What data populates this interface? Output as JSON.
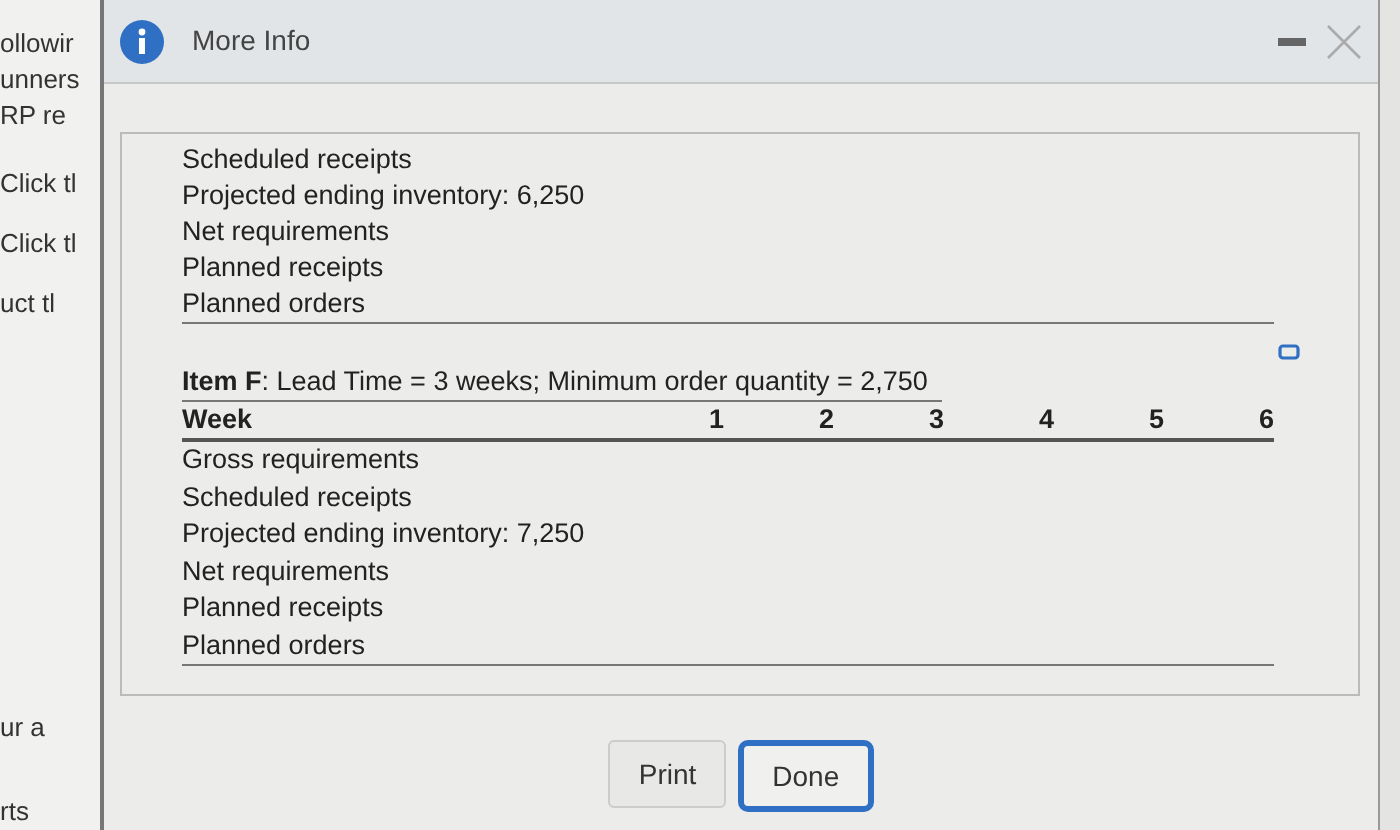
{
  "background_text": [
    "ollowir",
    "unners",
    "RP re",
    "Click tl",
    "Click tl",
    "uct tl",
    "ur a",
    "rts"
  ],
  "dialog": {
    "title": "More Info",
    "upper_table": {
      "rows": [
        "Scheduled receipts",
        "Projected ending inventory: 6,250",
        "Net requirements",
        "Planned receipts",
        "Planned orders"
      ]
    },
    "item_table": {
      "heading": "**Item F**: Lead Time = 3 weeks; Minimum order quantity = 2,750",
      "columns": [
        "Week",
        "1",
        "2",
        "3",
        "4",
        "5",
        "6"
      ],
      "rows": [
        "Gross requirements",
        "Scheduled receipts",
        "Projected ending inventory: 7,250",
        "Net requirements",
        "Planned receipts",
        "Planned orders"
      ]
    },
    "buttons": [
      {
        "label": "Print",
        "selected": false
      },
      {
        "label": "Done",
        "selected": true
      }
    ]
  }
}
